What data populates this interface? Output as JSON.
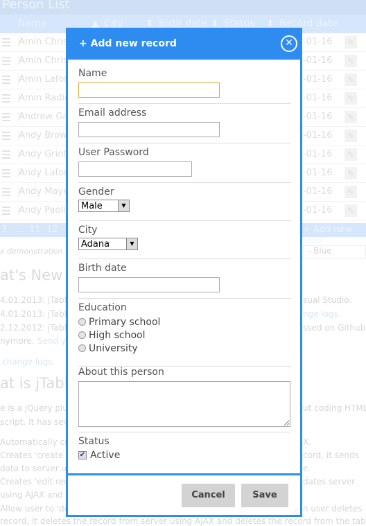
{
  "background": {
    "title": "Person List",
    "columns": [
      "Name",
      "City",
      "Birth date",
      "Status",
      "Record date"
    ],
    "rows": [
      {
        "name": "Amin Christ",
        "date": "-01-16"
      },
      {
        "name": "Amin Christ",
        "date": "-01-16"
      },
      {
        "name": "Amin Lafore",
        "date": "-01-16"
      },
      {
        "name": "Amin Radic",
        "date": "-01-16"
      },
      {
        "name": "Andrew Ga",
        "date": "-01-16"
      },
      {
        "name": "Andy Brown",
        "date": "-01-16"
      },
      {
        "name": "Andy Grint",
        "date": "-01-16"
      },
      {
        "name": "Andy Lafore",
        "date": "-01-16"
      },
      {
        "name": "Andy Mayer",
        "date": "-01-16"
      },
      {
        "name": "Andy Paolin",
        "date": "-01-16"
      }
    ],
    "pager": [
      "3",
      "...",
      "11",
      "12",
      "1"
    ],
    "add_new": "+ Add new reco",
    "demo_note": "x demonstration",
    "theme_select": "- Blue",
    "whats_new": "at's New",
    "news": [
      "4.01.2013: jTable",
      "4.01.2013: jTable",
      "2.12.2012: jTable",
      "nymore.",
      "Send y"
    ],
    "change_logs": "change logs.",
    "what_is": "at is jTable",
    "desc": [
      "e is a jQuery plug",
      "script. It has sev",
      "Automatically cre",
      "Creates 'create r",
      "data to server us",
      "Creates 'edit rec",
      "using AJAX and u",
      "Allow user to 'del",
      "record, it deletes the record from server using AJAX and deletes the record from the table"
    ],
    "right": [
      "sual Studio.",
      "nge logs.",
      "ssed on Github",
      "ut coding HTML",
      "X.",
      "cord, it sends",
      "e.",
      "dates server",
      "n user deletes"
    ]
  },
  "modal": {
    "title": "+ Add new record",
    "close_icon": "close-circle-icon",
    "name_label": "Name",
    "name_value": "",
    "email_label": "Email address",
    "email_value": "",
    "password_label": "User Password",
    "password_value": "",
    "gender_label": "Gender",
    "gender_value": "Male",
    "city_label": "City",
    "city_value": "Adana",
    "birth_label": "Birth date",
    "birth_value": "",
    "education_label": "Education",
    "education_options": [
      "Primary school",
      "High school",
      "University"
    ],
    "about_label": "About this person",
    "about_value": "",
    "status_label": "Status",
    "status_option": "Active",
    "status_checked": true,
    "cancel": "Cancel",
    "save": "Save",
    "accent": "#2e8bef"
  }
}
